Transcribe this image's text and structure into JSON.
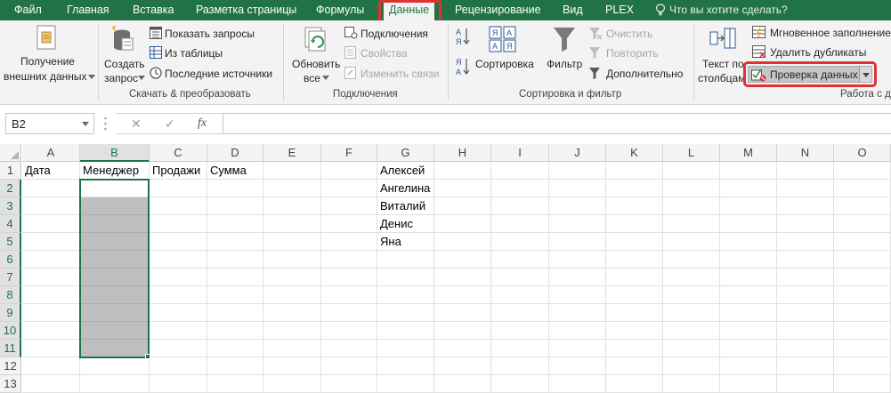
{
  "tabs": [
    "Файл",
    "Главная",
    "Вставка",
    "Разметка страницы",
    "Формулы",
    "Данные",
    "Рецензирование",
    "Вид",
    "PLEX"
  ],
  "tell_me": "Что вы хотите сделать?",
  "ribbon": {
    "get_external": {
      "line1": "Получение",
      "line2": "внешних данных"
    },
    "create_query": {
      "line1": "Создать",
      "line2": "запрос"
    },
    "show_queries": "Показать запросы",
    "from_table": "Из таблицы",
    "recent_sources": "Последние источники",
    "group_transform": "Скачать & преобразовать",
    "refresh_all": {
      "line1": "Обновить",
      "line2": "все"
    },
    "connections": "Подключения",
    "properties": "Свойства",
    "edit_links": "Изменить связи",
    "group_connections": "Подключения",
    "sort": "Сортировка",
    "filter": "Фильтр",
    "clear": "Очистить",
    "reapply": "Повторить",
    "advanced": "Дополнительно",
    "group_sort_filter": "Сортировка и фильтр",
    "text_to_columns": {
      "line1": "Текст по",
      "line2": "столбцам"
    },
    "flash_fill": "Мгновенное заполнение",
    "remove_duplicates": "Удалить дубликаты",
    "data_validation": "Проверка данных",
    "group_data_tools": "Работа с д"
  },
  "formula_bar": {
    "name_box": "B2",
    "cancel": "✕",
    "enter": "✓",
    "fx": "fx",
    "value": ""
  },
  "columns": [
    "A",
    "B",
    "C",
    "D",
    "E",
    "F",
    "G",
    "H",
    "I",
    "J",
    "K",
    "L",
    "M",
    "N",
    "O"
  ],
  "rows": [
    "1",
    "2",
    "3",
    "4",
    "5",
    "6",
    "7",
    "8",
    "9",
    "10",
    "11",
    "12",
    "13"
  ],
  "cells": {
    "A1": "Дата",
    "B1": "Менеджер",
    "C1": "Продажи",
    "D1": "Сумма",
    "G1": "Алексей",
    "G2": "Ангелина",
    "G3": "Виталий",
    "G4": "Денис",
    "G5": "Яна"
  },
  "colors": {
    "accent": "#217346",
    "highlight": "#e03232",
    "selection_fill": "#bfbfbf"
  }
}
